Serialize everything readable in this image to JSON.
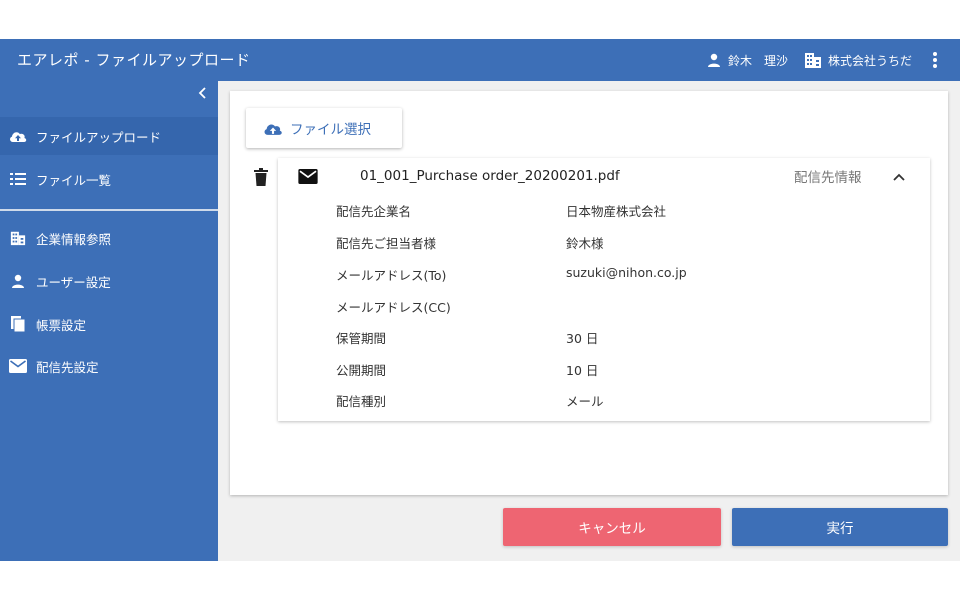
{
  "header": {
    "title": "エアレポ - ファイルアップロード",
    "user_icon": "person-icon",
    "user_name": "鈴木　理沙",
    "company_icon": "building-icon",
    "company_name": "株式会社うちだ",
    "menu_icon": "kebab-menu-icon"
  },
  "sidebar": {
    "collapse_icon": "chevron-left-icon",
    "items": [
      {
        "label": "ファイルアップロード",
        "icon": "cloud-upload-icon",
        "active": true
      },
      {
        "label": "ファイル一覧",
        "icon": "list-icon",
        "active": false
      },
      {
        "label": "企業情報参照",
        "icon": "building-icon",
        "active": false
      },
      {
        "label": "ユーザー設定",
        "icon": "person-icon",
        "active": false
      },
      {
        "label": "帳票設定",
        "icon": "documents-icon",
        "active": false
      },
      {
        "label": "配信先設定",
        "icon": "mail-icon",
        "active": false
      }
    ]
  },
  "main": {
    "file_select_label": "ファイル選択",
    "file": {
      "name": "01_001_Purchase order_20200201.pdf",
      "dest_info_label": "配信先情報",
      "details": [
        {
          "label": "配信先企業名",
          "value": "日本物産株式会社"
        },
        {
          "label": "配信先ご担当者様",
          "value": "鈴木様"
        },
        {
          "label": "メールアドレス(To)",
          "value": "suzuki@nihon.co.jp"
        },
        {
          "label": "メールアドレス(CC)",
          "value": ""
        },
        {
          "label": "保管期間",
          "value": "30 日"
        },
        {
          "label": "公開期間",
          "value": "10 日"
        },
        {
          "label": "配信種別",
          "value": "メール"
        }
      ]
    }
  },
  "footer": {
    "cancel_label": "キャンセル",
    "run_label": "実行"
  },
  "colors": {
    "primary": "#3d6fb7",
    "cancel": "#ee6572",
    "background": "#f0f0f0"
  }
}
